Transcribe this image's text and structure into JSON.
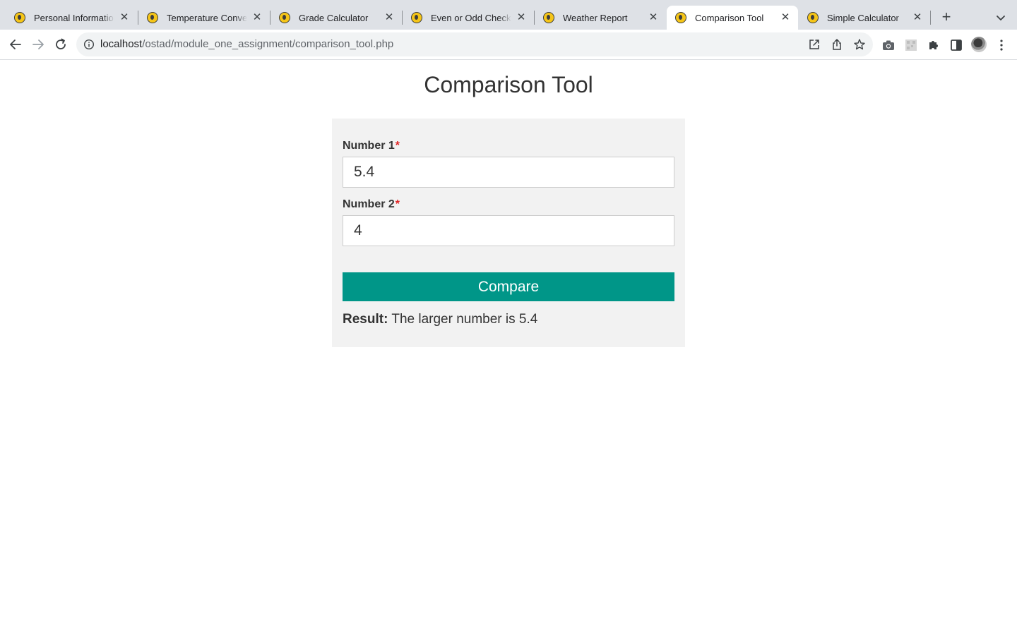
{
  "browser": {
    "tabs": [
      {
        "title": "Personal Information Form",
        "active": false
      },
      {
        "title": "Temperature Converter",
        "active": false
      },
      {
        "title": "Grade Calculator",
        "active": false
      },
      {
        "title": "Even or Odd Checker",
        "active": false
      },
      {
        "title": "Weather Report",
        "active": false
      },
      {
        "title": "Comparison Tool",
        "active": true
      },
      {
        "title": "Simple Calculator",
        "active": false
      }
    ],
    "url_host": "localhost",
    "url_path": "/ostad/module_one_assignment/comparison_tool.php"
  },
  "page": {
    "title": "Comparison Tool",
    "form": {
      "number1_label": "Number 1",
      "number1_value": "5.4",
      "number2_label": "Number 2",
      "number2_value": "4",
      "required_marker": "*",
      "submit_label": "Compare"
    },
    "result": {
      "label": "Result:",
      "text": "The larger number is 5.4"
    }
  },
  "colors": {
    "accent": "#009688",
    "required": "#e02424",
    "card_bg": "#f2f2f2"
  }
}
